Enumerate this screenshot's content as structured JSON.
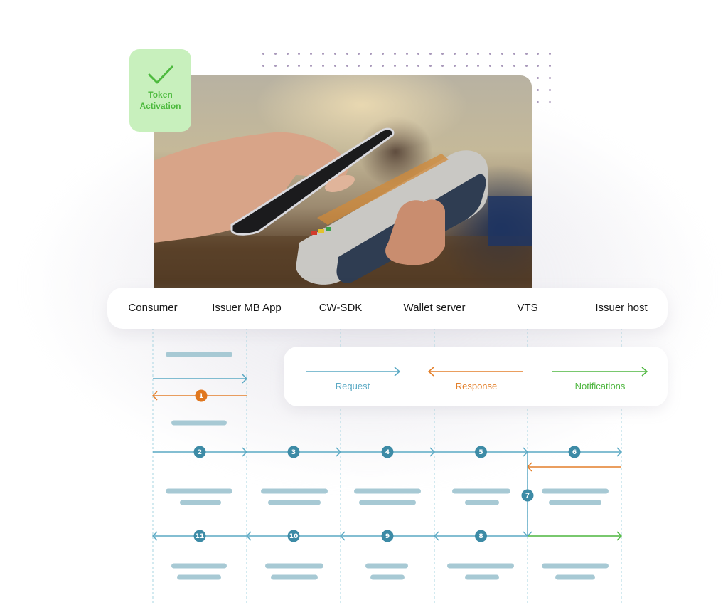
{
  "colors": {
    "request": "#5aa9c4",
    "response": "#e37f2a",
    "notification": "#4db63e",
    "step_badge": "#3d8ba6",
    "step_badge_response": "#e0771f",
    "placeholder_bar": "#a7c9d4",
    "lane_line": "#b6dbe6",
    "badge_bg": "#c8f0bd",
    "badge_text": "#4dba3e",
    "dots": "#a999bb"
  },
  "badge": {
    "icon": "checkmark-icon",
    "line1": "Token",
    "line2": "Activation"
  },
  "photo": {
    "description": "Hand holding smartphone tapping contactless payment terminal"
  },
  "lanes": [
    {
      "id": "consumer",
      "label": "Consumer"
    },
    {
      "id": "issuer-mb-app",
      "label": "Issuer MB App"
    },
    {
      "id": "cw-sdk",
      "label": "CW-SDK"
    },
    {
      "id": "wallet-server",
      "label": "Wallet server"
    },
    {
      "id": "vts",
      "label": "VTS"
    },
    {
      "id": "issuer-host",
      "label": "Issuer host"
    }
  ],
  "legend": {
    "items": [
      {
        "type": "request",
        "label": "Request",
        "direction": "right"
      },
      {
        "type": "response",
        "label": "Response",
        "direction": "left"
      },
      {
        "type": "notification",
        "label": "Notifications",
        "direction": "right"
      }
    ]
  },
  "messages": [
    {
      "step": null,
      "type": "request",
      "from": 0,
      "to": 1
    },
    {
      "step": "1",
      "type": "response",
      "from": 1,
      "to": 0
    },
    {
      "step": "2",
      "type": "request",
      "from": 0,
      "to": 1
    },
    {
      "step": "3",
      "type": "request",
      "from": 1,
      "to": 2
    },
    {
      "step": "4",
      "type": "request",
      "from": 2,
      "to": 3
    },
    {
      "step": "5",
      "type": "request",
      "from": 3,
      "to": 4
    },
    {
      "step": "6",
      "type": "request",
      "from": 4,
      "to": 5
    },
    {
      "step": null,
      "type": "response",
      "from": 5,
      "to": 4
    },
    {
      "step": "7",
      "type": "request",
      "from": 4,
      "to": 4,
      "self": true
    },
    {
      "step": "8",
      "type": "request",
      "from": 4,
      "to": 3
    },
    {
      "step": null,
      "type": "notification",
      "from": 4,
      "to": 5
    },
    {
      "step": "9",
      "type": "request",
      "from": 3,
      "to": 2
    },
    {
      "step": "10",
      "type": "request",
      "from": 2,
      "to": 1
    },
    {
      "step": "11",
      "type": "request",
      "from": 1,
      "to": 0
    }
  ]
}
